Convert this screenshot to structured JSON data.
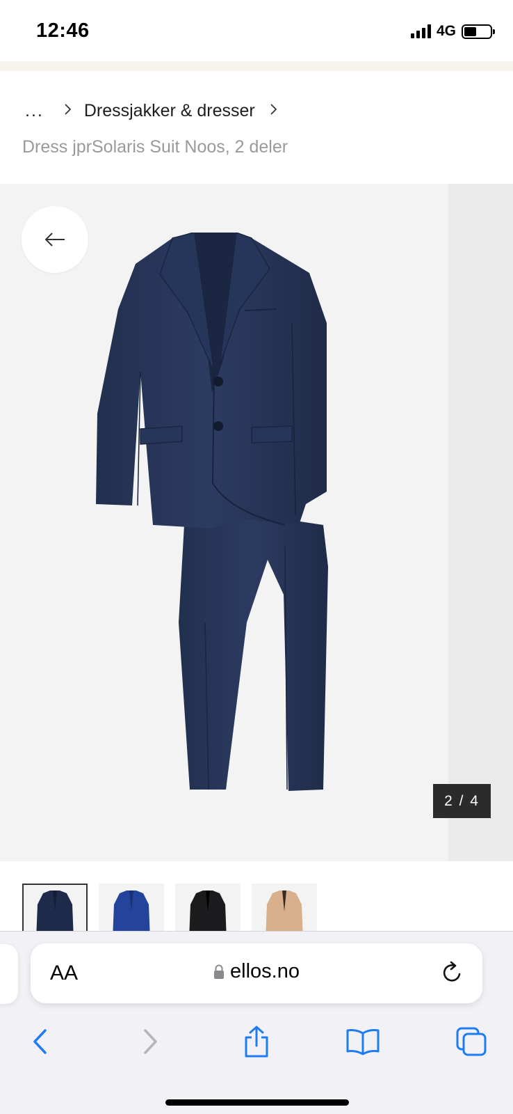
{
  "status_bar": {
    "time": "12:46",
    "network": "4G",
    "signal_icon": "signal-bars-icon",
    "battery_icon": "battery-icon"
  },
  "breadcrumb": {
    "ellipsis": "...",
    "category": "Dressjakker & dresser",
    "current": "Dress jprSolaris Suit Noos, 2 deler",
    "separator_icon": "chevron-right-icon"
  },
  "gallery": {
    "back_icon": "arrow-left-icon",
    "counter": "2 / 4",
    "product_color": "#26365a"
  },
  "thumbnails": [
    {
      "color": "#1f2b4a",
      "selected": true
    },
    {
      "color": "#23449a",
      "selected": false
    },
    {
      "color": "#1b1b1d",
      "selected": false
    },
    {
      "color": "#d8b08c",
      "selected": false
    }
  ],
  "browser": {
    "text_size_label": "AA",
    "domain": "ellos.no",
    "lock_icon": "lock-icon",
    "reload_icon": "reload-icon",
    "toolbar_icons": [
      "back-icon",
      "forward-icon",
      "share-icon",
      "bookmarks-icon",
      "tabs-icon"
    ],
    "accent_color": "#1e7cf2"
  }
}
